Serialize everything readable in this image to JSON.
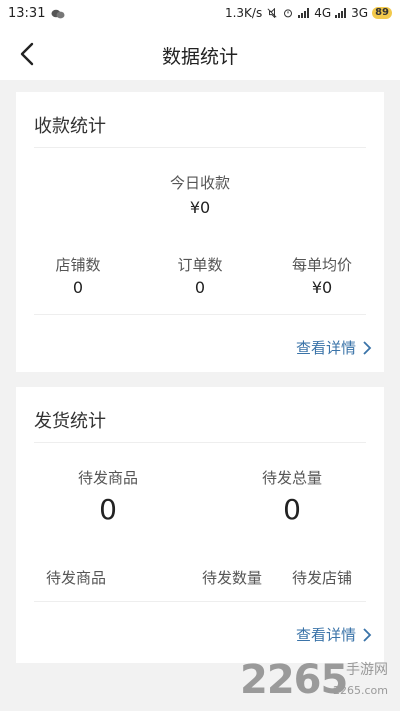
{
  "status_bar": {
    "time": "13:31",
    "net_speed": "1.3K/s",
    "net4g": "4G",
    "net3g": "3G",
    "battery": "89"
  },
  "header": {
    "title": "数据统计"
  },
  "collection": {
    "title": "收款统计",
    "today_label": "今日收款",
    "today_value": "¥0",
    "stats": [
      {
        "label": "店铺数",
        "value": "0"
      },
      {
        "label": "订单数",
        "value": "0"
      },
      {
        "label": "每单均价",
        "value": "¥0"
      }
    ],
    "detail_link": "查看详情"
  },
  "shipping": {
    "title": "发货统计",
    "top": [
      {
        "label": "待发商品",
        "value": "0"
      },
      {
        "label": "待发总量",
        "value": "0"
      }
    ],
    "columns": [
      "待发商品",
      "待发数量",
      "待发店铺"
    ],
    "detail_link": "查看详情"
  },
  "watermark": {
    "brand": "2265",
    "site": "手游网",
    "url": "2265.com"
  },
  "colors": {
    "accent_link": "#3a73a8",
    "background": "#f2f2f2",
    "battery": "#f2c94c"
  }
}
